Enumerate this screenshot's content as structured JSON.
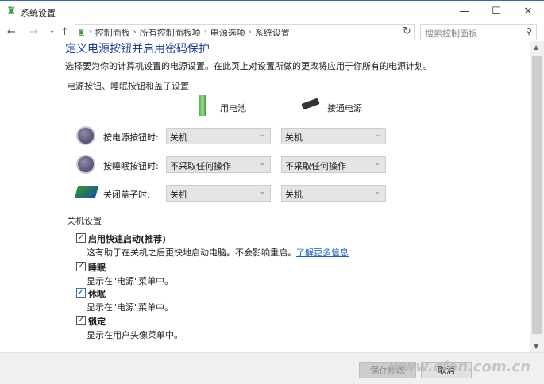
{
  "window": {
    "title": "系统设置",
    "minimize": "—",
    "maximize": "☐",
    "close": "✕"
  },
  "nav": {
    "back": "←",
    "forward": "→",
    "recent": "⌄",
    "up": "↑",
    "breadcrumbs": [
      "控制面板",
      "所有控制面板项",
      "电源选项",
      "系统设置"
    ],
    "dropdown": "⌄",
    "refresh": "↻",
    "search_placeholder": "搜索控制面板"
  },
  "page": {
    "heading": "定义电源按钮并启用密码保护",
    "description": "选择要为你的计算机设置的电源设置。在此页上对设置所做的更改将应用于你所有的电源计划。",
    "buttons_section": "电源按钮、睡眠按钮和盖子设置",
    "col_battery": "用电池",
    "col_plugged": "接通电源",
    "rows": [
      {
        "label": "按电源按钮时:",
        "battery": "关机",
        "plugged": "关机"
      },
      {
        "label": "按睡眠按钮时:",
        "battery": "不采取任何操作",
        "plugged": "不采取任何操作"
      },
      {
        "label": "关闭盖子时:",
        "battery": "关机",
        "plugged": "关机"
      }
    ],
    "shutdown_section": "关机设置",
    "options": [
      {
        "label": "启用快速启动(推荐)",
        "desc": "这有助于在关机之后更快地启动电脑。不会影响重启。",
        "link": "了解更多信息",
        "checked": true
      },
      {
        "label": "睡眠",
        "desc": "显示在\"电源\"菜单中。",
        "checked": true
      },
      {
        "label": "休眠",
        "desc": "显示在\"电源\"菜单中。",
        "checked": true
      },
      {
        "label": "锁定",
        "desc": "显示在用户头像菜单中。",
        "checked": true
      }
    ]
  },
  "footer": {
    "save": "保存修改",
    "cancel": "取消"
  },
  "watermark": "www.cfan.com.cn"
}
